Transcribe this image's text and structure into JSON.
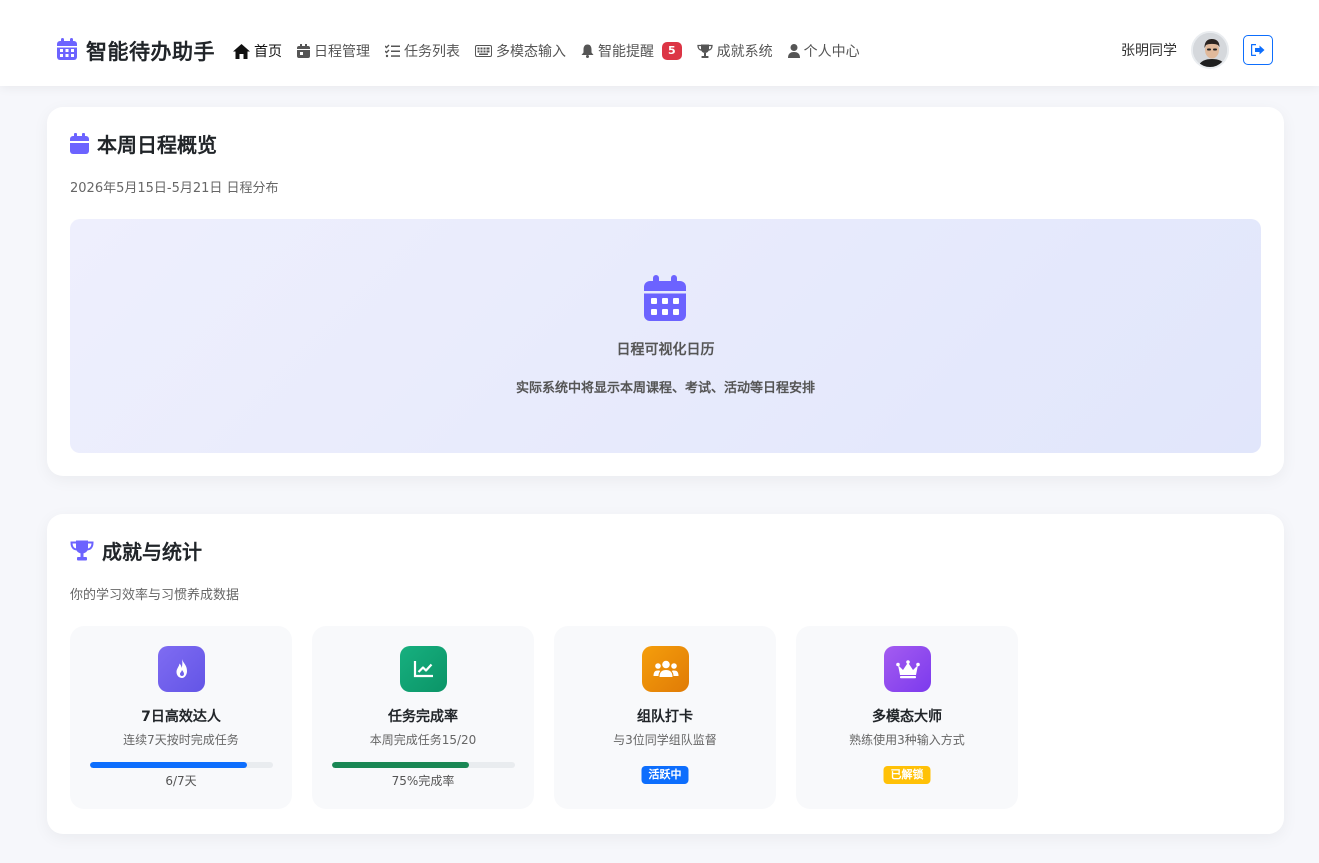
{
  "app": {
    "title": "智能待办助手",
    "brand_color": "#6c63ff"
  },
  "nav": {
    "items": [
      {
        "label": "首页",
        "icon": "home-icon"
      },
      {
        "label": "日程管理",
        "icon": "calendar-day-icon"
      },
      {
        "label": "任务列表",
        "icon": "list-check-icon"
      },
      {
        "label": "多模态输入",
        "icon": "keyboard-icon"
      },
      {
        "label": "智能提醒",
        "icon": "bell-icon",
        "badge": "5"
      },
      {
        "label": "成就系统",
        "icon": "trophy-icon"
      },
      {
        "label": "个人中心",
        "icon": "user-icon"
      }
    ],
    "active_index": 0
  },
  "user": {
    "name": "张明同学"
  },
  "schedule": {
    "title": "本周日程概览",
    "subtitle": "2026年5月15日-5月21日 日程分布",
    "placeholder_title": "日程可视化日历",
    "placeholder_desc": "实际系统中将显示本周课程、考试、活动等日程安排"
  },
  "achievements": {
    "title": "成就与统计",
    "subtitle": "你的学习效率与习惯养成数据",
    "cards": [
      {
        "title": "7日高效达人",
        "desc": "连续7天按时完成任务",
        "meta": "6/7天",
        "progress": 0.857,
        "icon": "fire-icon",
        "color": "#0d6efd"
      },
      {
        "title": "任务完成率",
        "desc": "本周完成任务15/20",
        "meta": "75%完成率",
        "progress": 0.75,
        "icon": "chart-line-icon",
        "color": "#198754"
      },
      {
        "title": "组队打卡",
        "desc": "与3位同学组队监督",
        "status": "活跃中",
        "icon": "users-icon",
        "color": "#0d6efd"
      },
      {
        "title": "多模态大师",
        "desc": "熟练使用3种输入方式",
        "status": "已解锁",
        "icon": "crown-icon",
        "color": "#ffc107"
      }
    ]
  }
}
